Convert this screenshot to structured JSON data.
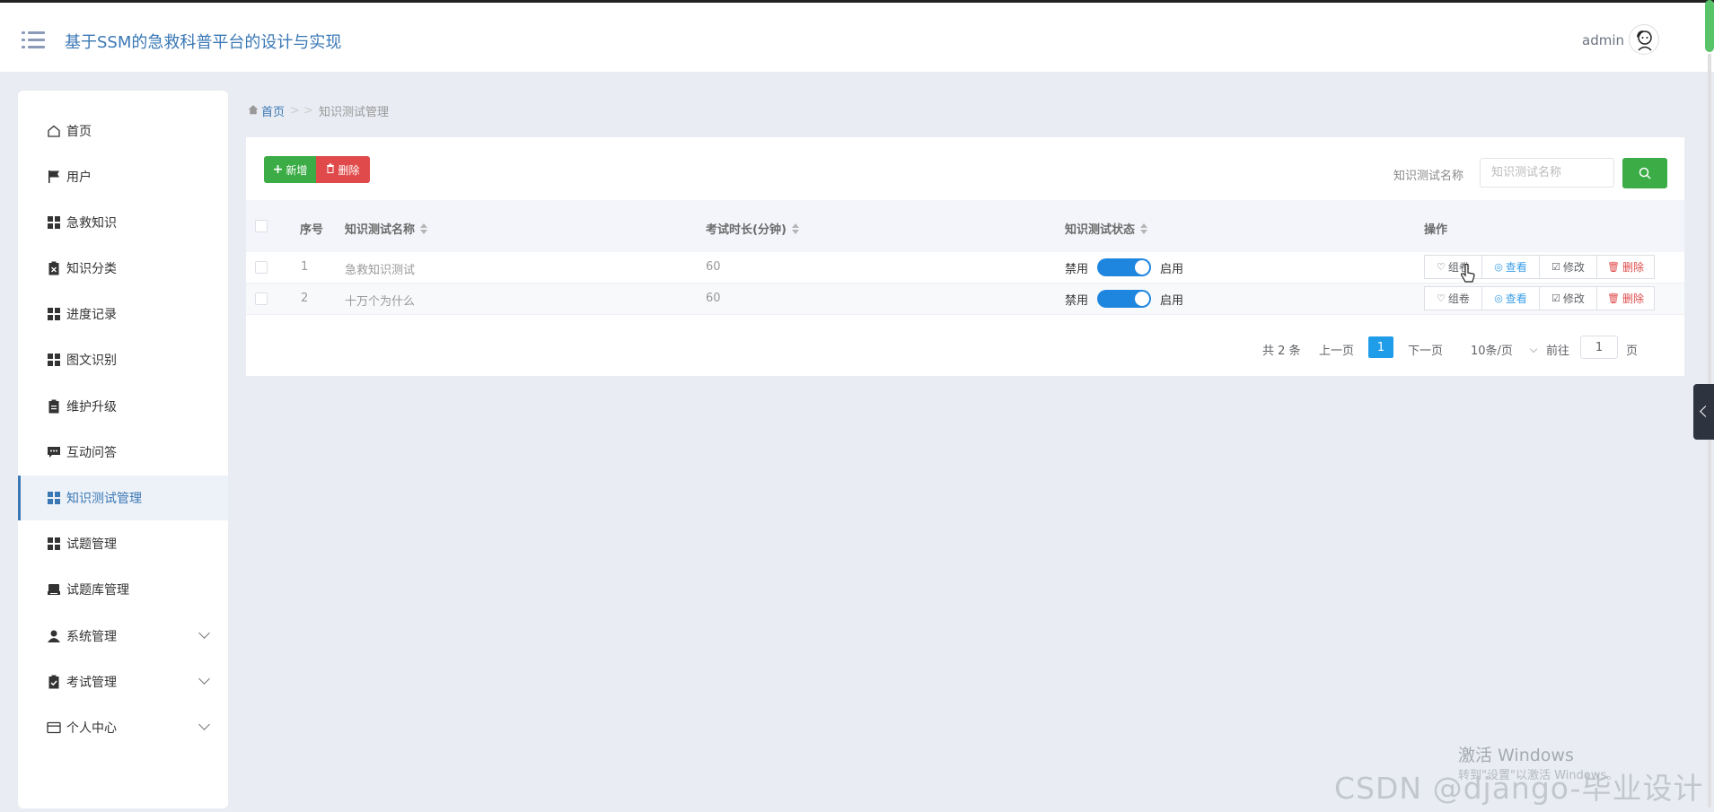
{
  "header": {
    "title": "基于SSM的急救科普平台的设计与实现",
    "user": "admin"
  },
  "sidebar": {
    "items": [
      {
        "label": "首页",
        "icon": "home-icon"
      },
      {
        "label": "用户",
        "icon": "flag-icon"
      },
      {
        "label": "急救知识",
        "icon": "grid-icon"
      },
      {
        "label": "知识分类",
        "icon": "clipboard-x-icon"
      },
      {
        "label": "进度记录",
        "icon": "grid-icon"
      },
      {
        "label": "图文识别",
        "icon": "grid-icon"
      },
      {
        "label": "维护升级",
        "icon": "clipboard-icon"
      },
      {
        "label": "互动问答",
        "icon": "chat-icon"
      },
      {
        "label": "知识测试管理",
        "icon": "grid-icon",
        "active": true
      },
      {
        "label": "试题管理",
        "icon": "grid-icon"
      },
      {
        "label": "试题库管理",
        "icon": "printer-icon"
      },
      {
        "label": "系统管理",
        "icon": "user-icon",
        "expandable": true
      },
      {
        "label": "考试管理",
        "icon": "clipboard-check-icon",
        "expandable": true
      },
      {
        "label": "个人中心",
        "icon": "card-icon",
        "expandable": true
      }
    ]
  },
  "breadcrumb": {
    "home": "首页",
    "separator": "> >",
    "current": "知识测试管理"
  },
  "toolbar": {
    "add_label": "新增",
    "delete_label": "删除",
    "search_label": "知识测试名称",
    "search_placeholder": "知识测试名称"
  },
  "table": {
    "columns": [
      "序号",
      "知识测试名称",
      "考试时长(分钟)",
      "知识测试状态",
      "操作"
    ],
    "rows": [
      {
        "index": "1",
        "name": "急救知识测试",
        "duration": "60",
        "status_off": "禁用",
        "status_on": "启用"
      },
      {
        "index": "2",
        "name": "十万个为什么",
        "duration": "60",
        "status_off": "禁用",
        "status_on": "启用"
      }
    ],
    "actions": [
      "组卷",
      "查看",
      "修改",
      "删除"
    ]
  },
  "pagination": {
    "total": "共 2 条",
    "prev": "上一页",
    "current": "1",
    "next": "下一页",
    "page_size": "10条/页",
    "goto_label": "前往",
    "goto_value": "1",
    "goto_suffix": "页"
  },
  "overlay": {
    "windows_activate_title": "激活 Windows",
    "windows_activate_sub": "转到\"设置\"以激活 Windows。",
    "watermark": "CSDN @django-毕业设计"
  },
  "colors": {
    "accent": "#3a78b5",
    "success": "#3cac46",
    "danger": "#e04a4a",
    "toggle": "#1f86e0",
    "page_active": "#1f9de9"
  }
}
